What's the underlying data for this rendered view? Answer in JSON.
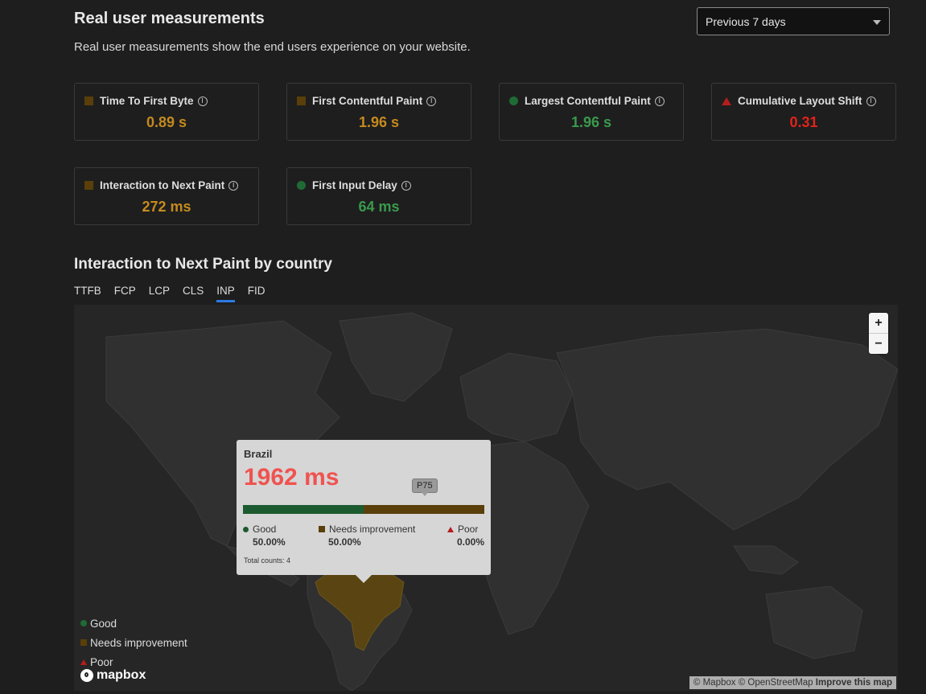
{
  "header": {
    "title": "Real user measurements",
    "subtitle": "Real user measurements show the end users experience on your website.",
    "range_select": "Previous 7 days"
  },
  "colors": {
    "good": "#1f6b35",
    "needs_improvement": "#5a3f0a",
    "poor": "#b51d1d",
    "tab_active": "#2d7be5"
  },
  "metrics": [
    {
      "label": "Time To First Byte",
      "value": "0.89 s",
      "status": "needs-improvement",
      "icon": "square-icon"
    },
    {
      "label": "First Contentful Paint",
      "value": "1.96 s",
      "status": "needs-improvement",
      "icon": "square-icon"
    },
    {
      "label": "Largest Contentful Paint",
      "value": "1.96 s",
      "status": "good",
      "icon": "circle-icon"
    },
    {
      "label": "Cumulative Layout Shift",
      "value": "0.31",
      "status": "poor",
      "icon": "triangle-icon"
    },
    {
      "label": "Interaction to Next Paint",
      "value": "272 ms",
      "status": "needs-improvement",
      "icon": "square-icon"
    },
    {
      "label": "First Input Delay",
      "value": "64 ms",
      "status": "good",
      "icon": "circle-icon"
    }
  ],
  "section": {
    "title": "Interaction to Next Paint by country",
    "tabs": [
      "TTFB",
      "FCP",
      "LCP",
      "CLS",
      "INP",
      "FID"
    ],
    "active_tab": "INP"
  },
  "map": {
    "zoom_in": "+",
    "zoom_out": "−",
    "tooltip": {
      "country": "Brazil",
      "value": "1962 ms",
      "marker": "P75",
      "marker_position": 0.75,
      "good_label": "Good",
      "good_pct": "50.00%",
      "good_share": 0.5,
      "needs_label": "Needs improvement",
      "needs_pct": "50.00%",
      "needs_share": 0.5,
      "poor_label": "Poor",
      "poor_pct": "0.00%",
      "poor_share": 0,
      "total": "Total counts: 4"
    },
    "legend": {
      "good": "Good",
      "needs": "Needs improvement",
      "poor": "Poor"
    },
    "logo": "mapbox",
    "attribution": {
      "mapbox": "© Mapbox",
      "osm": "© OpenStreetMap",
      "improve": "Improve this map"
    }
  }
}
